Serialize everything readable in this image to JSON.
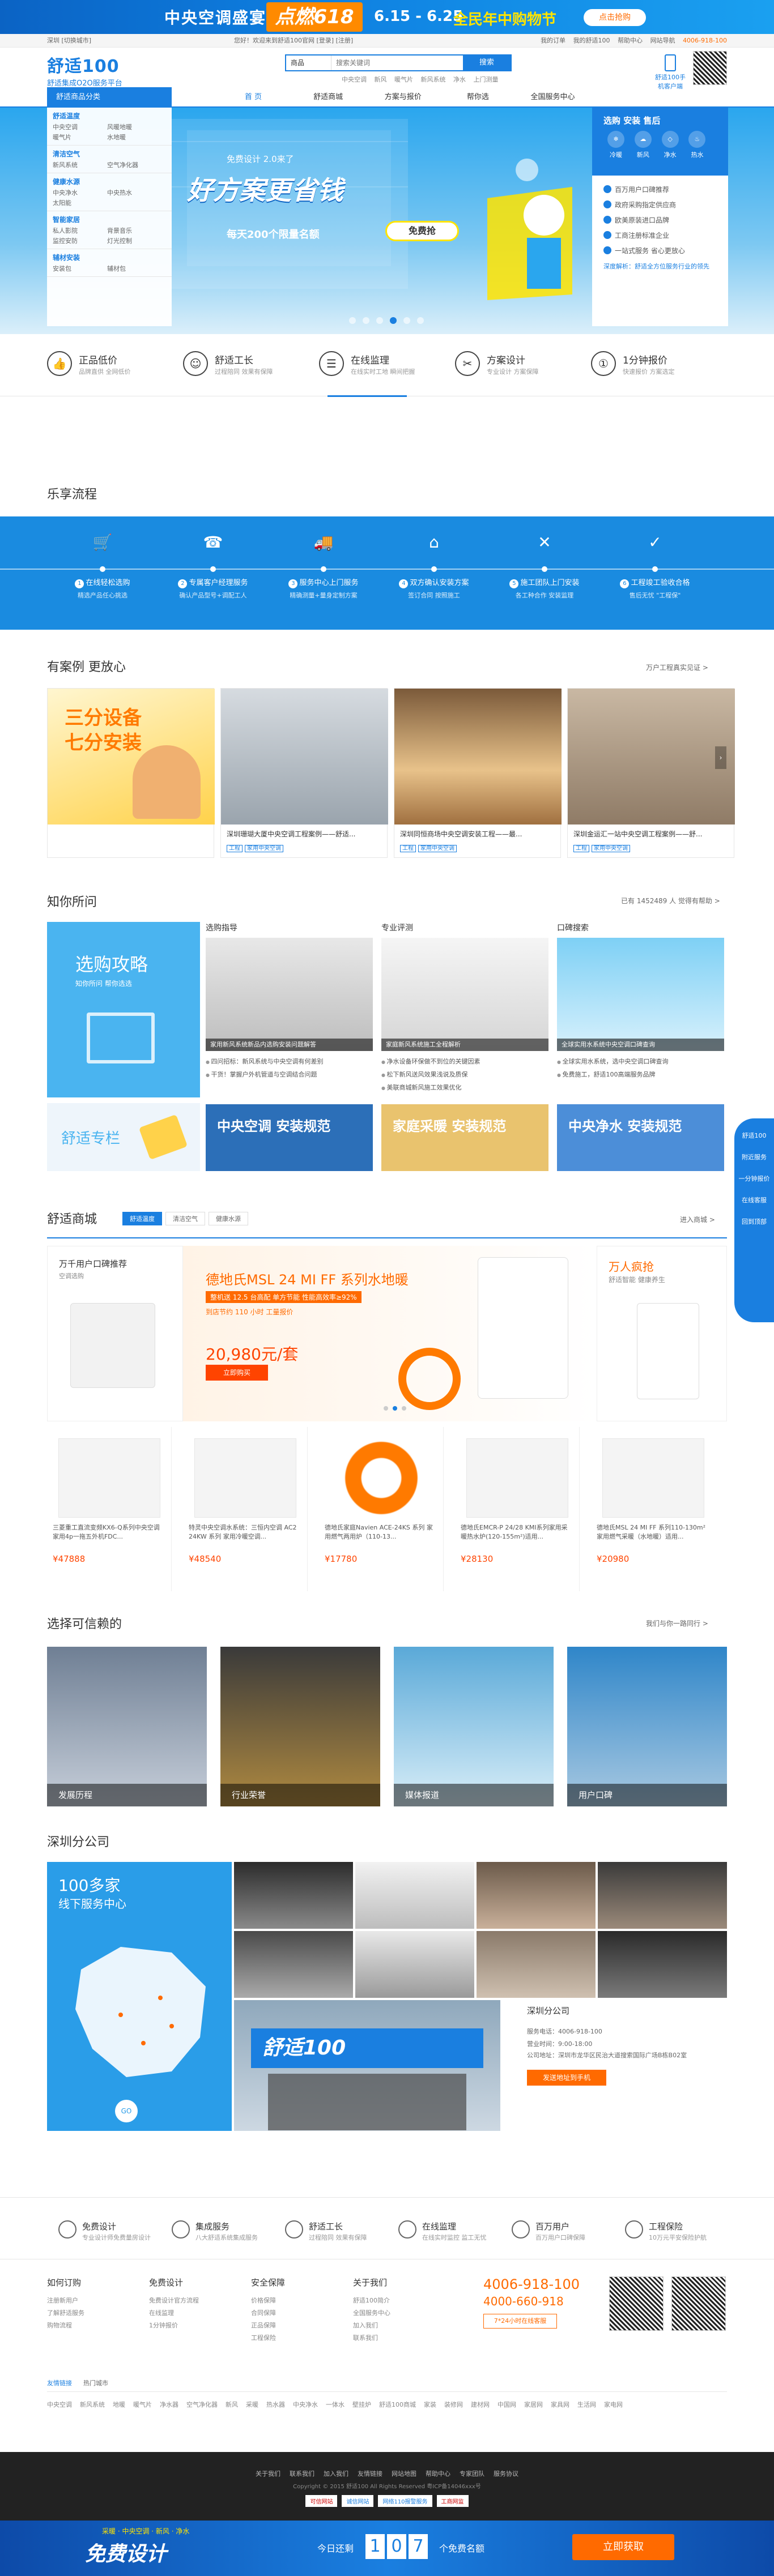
{
  "top_banner": {
    "title": "中央空调盛宴",
    "badge": "点燃618",
    "dates": "6.15 - 6.25",
    "tagline": "全民年中购物节",
    "cta": "点击抢购"
  },
  "util": {
    "location": "深圳 [切换城市]",
    "welcome": "您好！欢迎来到舒适100官网 [登录] [注册]",
    "links": [
      "我的订单",
      "我的舒适100",
      "帮助中心",
      "网站导航"
    ],
    "phone": "4006-918-100"
  },
  "header": {
    "logo": "舒适100",
    "logo_sub": "舒适集成O2O服务平台",
    "search_cat": "商品",
    "search_placeholder": "搜索关键词",
    "search_btn": "搜索",
    "hotwords": [
      "中央空调",
      "新风",
      "暖气片",
      "新风系统",
      "净水",
      "上门测量"
    ],
    "app_label": "舒适100手机客户端"
  },
  "nav": {
    "category_head": "舒适商品分类",
    "items": [
      "首 页",
      "舒适商城",
      "方案与报价",
      "帮你选",
      "全国服务中心"
    ]
  },
  "categories": [
    {
      "title": "舒适温度",
      "subs": [
        "中央空调",
        "风暖地暖",
        "暖气片",
        "水地暖"
      ]
    },
    {
      "title": "清洁空气",
      "subs": [
        "新风系统",
        "空气净化器"
      ]
    },
    {
      "title": "健康水源",
      "subs": [
        "中央净水",
        "中央热水",
        "太阳能"
      ]
    },
    {
      "title": "智能家居",
      "subs": [
        "私人影院",
        "背景音乐",
        "监控安防",
        "灯光控制"
      ]
    },
    {
      "title": "辅材安装",
      "subs": [
        "安装包",
        "辅材包"
      ]
    }
  ],
  "hero": {
    "sub": "免费设计 2.0来了",
    "slogan": "好方案更省钱",
    "sub2": "每天200个限量名额",
    "cta": "免费抢"
  },
  "hero_right": {
    "title": "选购 安装 售后",
    "icons": [
      "冷暖",
      "新风",
      "净水",
      "热水"
    ],
    "list": [
      "百万用户口碑推荐",
      "政府采购指定供应商",
      "欧美原装进口品牌",
      "工商注册标准企业",
      "一站式服务 省心更放心"
    ],
    "footer": "深度解析：舒适全方位服务行业的领先"
  },
  "features": [
    {
      "title": "正品低价",
      "desc": "品牌直供 全网低价"
    },
    {
      "title": "舒适工长",
      "desc": "过程陪同 效果有保障"
    },
    {
      "title": "在线监理",
      "desc": "在线实时工地 瞬间把握"
    },
    {
      "title": "方案设计",
      "desc": "专业设计 方案保障"
    },
    {
      "title": "1分钟报价",
      "desc": "快速报价 方案选定"
    }
  ],
  "process": {
    "title": "乐享流程",
    "steps": [
      {
        "n": "1",
        "title": "在线轻松选购",
        "desc": "精选产品任心挑选"
      },
      {
        "n": "2",
        "title": "专属客户经理服务",
        "desc": "确认产品型号+调配工人"
      },
      {
        "n": "3",
        "title": "服务中心上门服务",
        "desc": "精确测量+量身定制方案"
      },
      {
        "n": "4",
        "title": "双方确认安装方案",
        "desc": "签订合同 按照施工"
      },
      {
        "n": "5",
        "title": "施工团队上门安装",
        "desc": "各工种合作 安装监理"
      },
      {
        "n": "6",
        "title": "工程竣工验收合格",
        "desc": "售后无忧 \"工程保\""
      }
    ]
  },
  "cases": {
    "title": "有案例 更放心",
    "more": "万户工程真实见证 >",
    "items": [
      {
        "caption": "三分设备七分安装",
        "tags": []
      },
      {
        "caption": "深圳珊瑚大厦中央空调工程案例——舒适...",
        "tags": [
          "工程",
          "家用中央空调"
        ]
      },
      {
        "caption": "深圳同恒商场中央空调安装工程——最...",
        "tags": [
          "工程",
          "家用中央空调"
        ]
      },
      {
        "caption": "深圳金运汇一站中央空调工程案例——舒...",
        "tags": [
          "工程",
          "家用中央空调"
        ]
      }
    ]
  },
  "knowledge": {
    "title": "知你所问",
    "count_text": "已有 1452489 人 觉得有帮助 >",
    "guide_title": "选购攻略",
    "guide_sub": "知你所问  帮你选选",
    "column_title": "舒适专栏",
    "cards": [
      {
        "title": "选购指导",
        "cap": "家用新风系统新品内选购安装问题解答",
        "list": [
          "四问招标：新风系统与中央空调有何差别",
          "干货！掌握户外机管道与空调结合问题"
        ]
      },
      {
        "title": "专业评测",
        "cap": "家庭新风系统施工全程解析",
        "list": [
          "净水设备环保做不到位的关键因素",
          "松下新风送风效果浅说及质保",
          "美联商城新风施工效果优化"
        ]
      },
      {
        "title": "口碑搜索",
        "cap": "全球实用水系统中央空调口碑查询",
        "list": [
          "全球实用水系统，选中央空调口碑查询",
          "免费施工，舒适100高端服务品牌"
        ]
      }
    ],
    "tiles": [
      "中央空调 安装规范",
      "家庭采暖 安装规范",
      "中央净水 安装规范"
    ]
  },
  "mall": {
    "title": "舒适商城",
    "tabs": [
      "舒适温度",
      "清洁空气",
      "健康水源"
    ],
    "more": "进入商城 >",
    "promo_left": {
      "title": "万千用户口碑推荐",
      "sub": "空调选购"
    },
    "promo_main": {
      "title": "德地氏MSL 24 MI FF 系列水地暖",
      "sub": "整机送 12.5 台高配 单方节能 性能高效率≥92%",
      "sub2": "到店节约 110 小时 工量报价",
      "price": "20,980元/套",
      "cta": "立即购买"
    },
    "promo_right": {
      "title": "万人疯抢",
      "sub": "舒适智能 健康养生"
    },
    "products": [
      {
        "name": "三菱重工直流变频KX6-Q系列中央空调家用4p一拖五外机FDC...",
        "price": "¥47888",
        "brand": "三菱重工"
      },
      {
        "name": "特灵中央空调水系统：三恒内空调 AC2 24KW 系列 家用冷暖空调...",
        "price": "¥48540"
      },
      {
        "name": "德地氏家庭Navien ACE-24KS 系列 家用燃气两用炉（110-13...",
        "price": "¥17780"
      },
      {
        "name": "德地氏EMCR-P 24/28 KMI系列家用采暖热水炉(120-155m²)适用...",
        "price": "¥28130"
      },
      {
        "name": "德地氏MSL 24 MI FF 系列110-130m² 家用燃气采暖（水地暖）适用...",
        "price": "¥20980"
      }
    ]
  },
  "trust": {
    "title": "选择可信赖的",
    "more": "我们与你一路同行 >",
    "items": [
      "发展历程",
      "行业荣誉",
      "媒体报道",
      "用户口碑"
    ]
  },
  "branch": {
    "title": "深圳分公司",
    "map_title": "100多家",
    "map_sub": "线下服务中心",
    "name": "深圳分公司",
    "phone": "服务电话：4006-918-100",
    "hours": "营业时间：9:00-18:00",
    "address": "公司地址：深圳市龙华区民治大道搜索国际广场B栋B02室",
    "store_sign": "舒适100",
    "cta": "发送地址到手机"
  },
  "foot_features": [
    {
      "title": "免费设计",
      "desc": "专业设计师免费量房设计"
    },
    {
      "title": "集成服务",
      "desc": "八大舒适系统集成服务"
    },
    {
      "title": "舒适工长",
      "desc": "过程陪同 效果有保障"
    },
    {
      "title": "在线监理",
      "desc": "在线实时监控 监工无忧"
    },
    {
      "title": "百万用户",
      "desc": "百万用户口碑保障"
    },
    {
      "title": "工程保险",
      "desc": "10万元平安保险护航"
    }
  ],
  "foot_cols": [
    {
      "h": "如何订购",
      "items": [
        "注册新用户",
        "了解舒适服务",
        "购物流程"
      ]
    },
    {
      "h": "免费设计",
      "items": [
        "免费设计官方流程",
        "在线监理",
        "1分钟报价"
      ]
    },
    {
      "h": "安全保障",
      "items": [
        "价格保障",
        "合同保障",
        "正品保障",
        "工程保险"
      ]
    },
    {
      "h": "关于我们",
      "items": [
        "舒适100简介",
        "全国服务中心",
        "加入我们",
        "联系我们"
      ]
    }
  ],
  "foot_phone": {
    "p1": "4006-918-100",
    "p2": "4000-660-918",
    "cta": "7*24小时在线客服"
  },
  "friend_links": {
    "tabs": [
      "友情链接",
      "热门城市"
    ],
    "items": [
      "中央空调",
      "新风系统",
      "地暖",
      "暖气片",
      "净水器",
      "空气净化器",
      "新风",
      "采暖",
      "热水器",
      "中央净水",
      "一体水",
      "壁挂炉",
      "舒适100商城",
      "家装",
      "装修网",
      "建材网",
      "中国网",
      "家居网",
      "家具网",
      "生活网",
      "家电网"
    ]
  },
  "bottom": {
    "links": [
      "关于我们",
      "联系我们",
      "加入我们",
      "友情链接",
      "网站地图",
      "帮助中心",
      "专家团队",
      "服务协议"
    ],
    "copyright": "Copyright © 2015 舒适100 All Rights Reserved 粤ICP备14046xxx号",
    "badges": [
      "可信网站",
      "诚信网站",
      "网络110报警服务",
      "工商网监"
    ]
  },
  "bottom_fixed": {
    "title": "免费设计",
    "sub": "采暖 · 中央空调 · 新风 · 净水",
    "today": "今日还剩",
    "digits": [
      "1",
      "0",
      "7"
    ],
    "unit": "个免费名额",
    "cta": "立即获取"
  },
  "float_bar": {
    "items": [
      "舒适100",
      "附近服务",
      "一分钟报价",
      "在线客服",
      "回到顶部"
    ]
  }
}
